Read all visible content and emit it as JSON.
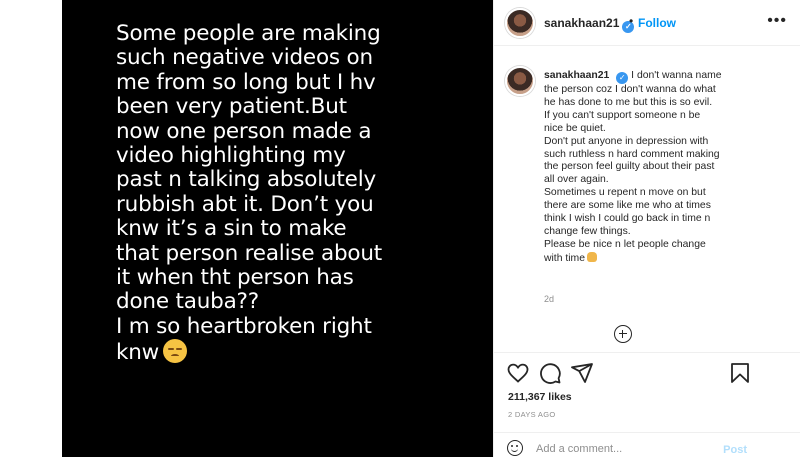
{
  "media": {
    "story_text": "Some people are making\nsuch negative videos on\nme from so long but I hv\nbeen very patient.But\nnow one person made a\nvideo highlighting my\npast n talking absolutely\nrubbish abt it. Don’t you\nknw it’s a sin to make\nthat person realise about\nit when tht person has\ndone tauba??\nI m so heartbroken right\nknw"
  },
  "header": {
    "username": "sanakhaan21",
    "dot": "•",
    "follow_label": "Follow",
    "more_label": "•••",
    "avatar_icon": "profile-avatar"
  },
  "caption": {
    "username": "sanakhaan21",
    "lines": [
      "I don't wanna name",
      "the person coz I don't wanna do what",
      "he has done to me but this is so evil.",
      "If you can't support someone n be",
      "nice be quiet.",
      "Don't put anyone in depression with",
      "such ruthless n hard comment making",
      "the person feel guilty about their past",
      "all over again.",
      "Sometimes u repent n move on but",
      "there are some like me who at times",
      "think I wish I could go back in time n",
      "change few things.",
      "Please be nice n let people change",
      "with time"
    ],
    "age": "2d"
  },
  "actions": {
    "likes": "211,367 likes",
    "date": "2 DAYS AGO",
    "icons": [
      "heart-icon",
      "comment-icon",
      "share-icon",
      "save-icon"
    ]
  },
  "comment_box": {
    "placeholder": "Add a comment...",
    "post_label": "Post",
    "post_color": "#b2dffc"
  },
  "colors": {
    "accent": "#0095f6",
    "verified": "#3897f0",
    "muted": "#8e8e8e"
  }
}
